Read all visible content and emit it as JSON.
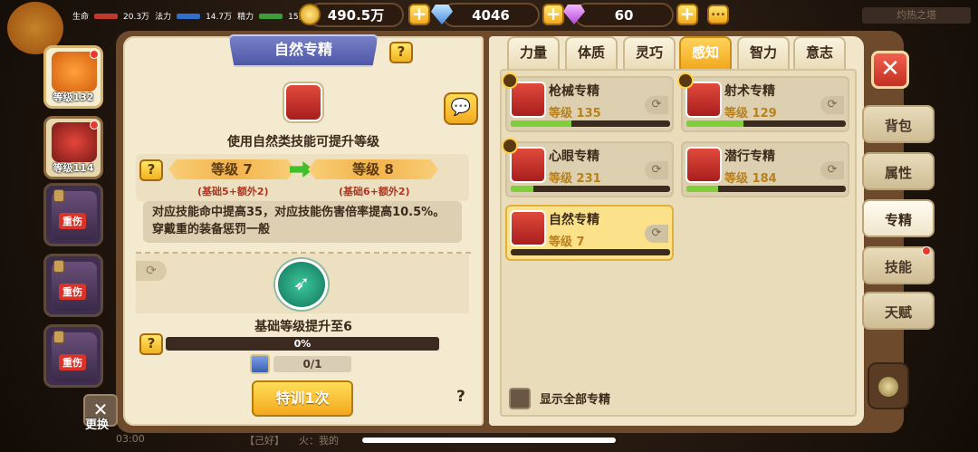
{
  "hud": {
    "hp_label": "生命",
    "hp_value": "20.3万",
    "mp_label": "法力",
    "mp_value": "14.7万",
    "stamina_label": "精力",
    "stamina_value": "15家",
    "hero_level": "等级"
  },
  "resources": {
    "gold": "490.5万",
    "diamond": "4046",
    "gem": "60"
  },
  "tower_title": "灼热之塔",
  "heroes": [
    {
      "level": "等级132"
    },
    {
      "level": "等级114"
    }
  ],
  "locked_heroes": [
    {
      "tag": "重伤"
    },
    {
      "tag": "重伤"
    },
    {
      "tag": "重伤"
    }
  ],
  "swap_label": "更换",
  "left_page": {
    "title": "自然专精",
    "help": "?",
    "hint": "使用自然类技能可提升等级",
    "level_from": "等级 7",
    "level_to": "等级 8",
    "level_from_sub": "(基础5+额外2)",
    "level_to_sub": "(基础6+额外2)",
    "description": "对应技能命中提高35，对应技能伤害倍率提高10.5%。穿戴重的装备惩罚一般",
    "base_upgrade": "基础等级提升至6",
    "progress": "0%",
    "progress_value": 0,
    "cost": "0/1",
    "train_button": "特训1次",
    "question": "?"
  },
  "tabs": [
    "力量",
    "体质",
    "灵巧",
    "感知",
    "智力",
    "意志"
  ],
  "active_tab": 3,
  "specs": [
    {
      "name": "枪械专精",
      "level": "等级 135",
      "fill": 0.38,
      "crown": true
    },
    {
      "name": "射术专精",
      "level": "等级 129",
      "fill": 0.36,
      "crown": true
    },
    {
      "name": "心眼专精",
      "level": "等级 231",
      "fill": 0.14,
      "crown": true
    },
    {
      "name": "潜行专精",
      "level": "等级 184",
      "fill": 0.2,
      "crown": false
    },
    {
      "name": "自然专精",
      "level": "等级 7",
      "fill": 0.0,
      "crown": false
    }
  ],
  "show_all_label": "显示全部专精",
  "side_tabs": [
    "背包",
    "属性",
    "专精",
    "技能",
    "天赋"
  ],
  "close_icon": "✕",
  "bottom": {
    "time": "03:00",
    "mid": "【己好】",
    "right": "火：我的"
  }
}
